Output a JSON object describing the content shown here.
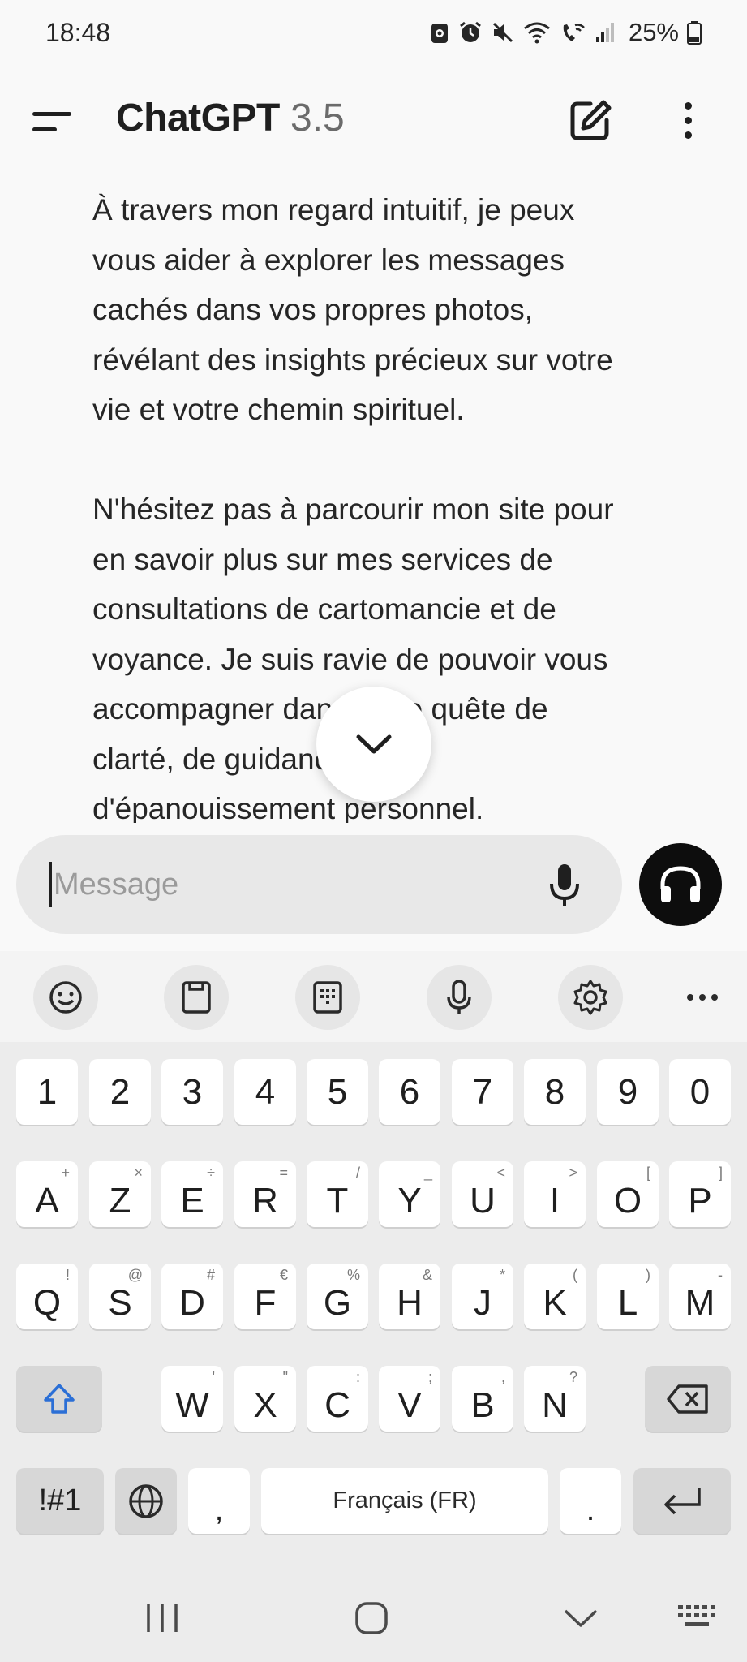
{
  "status_bar": {
    "time": "18:48",
    "battery": "25%",
    "icons": [
      "cast-icon",
      "alarm-icon",
      "mute-icon",
      "wifi-icon",
      "wifi-call-icon",
      "signal-icon",
      "battery-icon"
    ]
  },
  "app_bar": {
    "title": "ChatGPT",
    "version": "3.5",
    "icons": [
      "menu-icon",
      "edit-icon",
      "more-vertical-icon"
    ]
  },
  "conversation": {
    "paragraphs": [
      "À travers mon regard intuitif, je peux\nvous aider à explorer les messages\ncachés dans vos propres photos,\nrévélant des insights précieux sur votre\nvie et votre chemin spirituel.",
      "N'hésitez pas à parcourir mon site pour\nen savoir plus sur mes services de\nconsultations de cartomancie et de\nvoyance. Je suis ravie de pouvoir vous\naccompagner dans votre quête de\nclarté, de guidance et\nd'épanouissement personnel."
    ]
  },
  "composer": {
    "placeholder": "Message",
    "icons": [
      "mic-icon",
      "headphones-icon"
    ]
  },
  "keyboard": {
    "toolbar_icons": [
      "emoji-icon",
      "clipboard-icon",
      "keypad-icon",
      "mic-icon",
      "settings-icon",
      "more-horizontal-icon"
    ],
    "number_row": [
      "1",
      "2",
      "3",
      "4",
      "5",
      "6",
      "7",
      "8",
      "9",
      "0"
    ],
    "row1": [
      {
        "key": "A",
        "sub": "+"
      },
      {
        "key": "Z",
        "sub": "×"
      },
      {
        "key": "E",
        "sub": "÷"
      },
      {
        "key": "R",
        "sub": "="
      },
      {
        "key": "T",
        "sub": "/"
      },
      {
        "key": "Y",
        "sub": "_"
      },
      {
        "key": "U",
        "sub": "<"
      },
      {
        "key": "I",
        "sub": ">"
      },
      {
        "key": "O",
        "sub": "["
      },
      {
        "key": "P",
        "sub": "]"
      }
    ],
    "row2": [
      {
        "key": "Q",
        "sub": "!"
      },
      {
        "key": "S",
        "sub": "@"
      },
      {
        "key": "D",
        "sub": "#"
      },
      {
        "key": "F",
        "sub": "€"
      },
      {
        "key": "G",
        "sub": "%"
      },
      {
        "key": "H",
        "sub": "&"
      },
      {
        "key": "J",
        "sub": "*"
      },
      {
        "key": "K",
        "sub": "("
      },
      {
        "key": "L",
        "sub": ")"
      },
      {
        "key": "M",
        "sub": "-"
      }
    ],
    "row3": [
      {
        "key": "W",
        "sub": "'"
      },
      {
        "key": "X",
        "sub": "\""
      },
      {
        "key": "C",
        "sub": ":"
      },
      {
        "key": "V",
        "sub": ";"
      },
      {
        "key": "B",
        "sub": ","
      },
      {
        "key": "N",
        "sub": "?"
      }
    ],
    "bottom_row": {
      "symbols": "!#1",
      "comma": ",",
      "space": "Français (FR)",
      "period": "."
    }
  },
  "nav_bar": {
    "icons": [
      "recent-apps-icon",
      "home-icon",
      "back-icon",
      "keyboard-hide-icon"
    ]
  }
}
